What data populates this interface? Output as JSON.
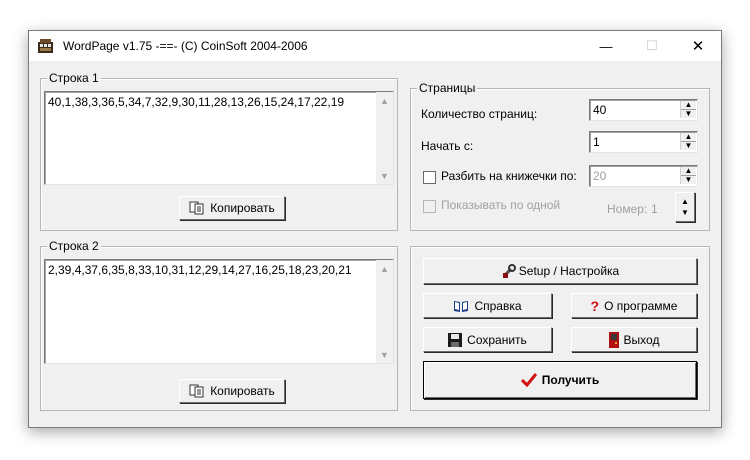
{
  "window": {
    "title": "WordPage v1.75 -==- (C) CoinSoft 2004-2006",
    "minimize_glyph": "—",
    "maximize_glyph": "☐",
    "close_glyph": "✕",
    "app_icon": "wordpage-app-icon"
  },
  "row1": {
    "legend": "Строка 1",
    "value": "40,1,38,3,36,5,34,7,32,9,30,11,28,13,26,15,24,17,22,19",
    "copy_label": "Копировать"
  },
  "row2": {
    "legend": "Строка 2",
    "value": "2,39,4,37,6,35,8,33,10,31,12,29,14,27,16,25,18,23,20,21",
    "copy_label": "Копировать"
  },
  "pages": {
    "legend": "Страницы",
    "count_label": "Количество страниц:",
    "count_value": "40",
    "start_label": "Начать с:",
    "start_value": "1",
    "split_label": "Разбить на книжечки по:",
    "split_value": "20",
    "show_one_label": "Показывать по одной",
    "number_label": "Номер:",
    "number_value": "1"
  },
  "actions": {
    "setup_label": "Setup / Настройка",
    "help_label": "Справка",
    "about_label": "О программе",
    "save_label": "Сохранить",
    "exit_label": "Выход",
    "get_label": "Получить"
  },
  "colors": {
    "window_bg": "#f0f0f0",
    "check_mark": "#d01010",
    "question_mark": "#d01010"
  }
}
